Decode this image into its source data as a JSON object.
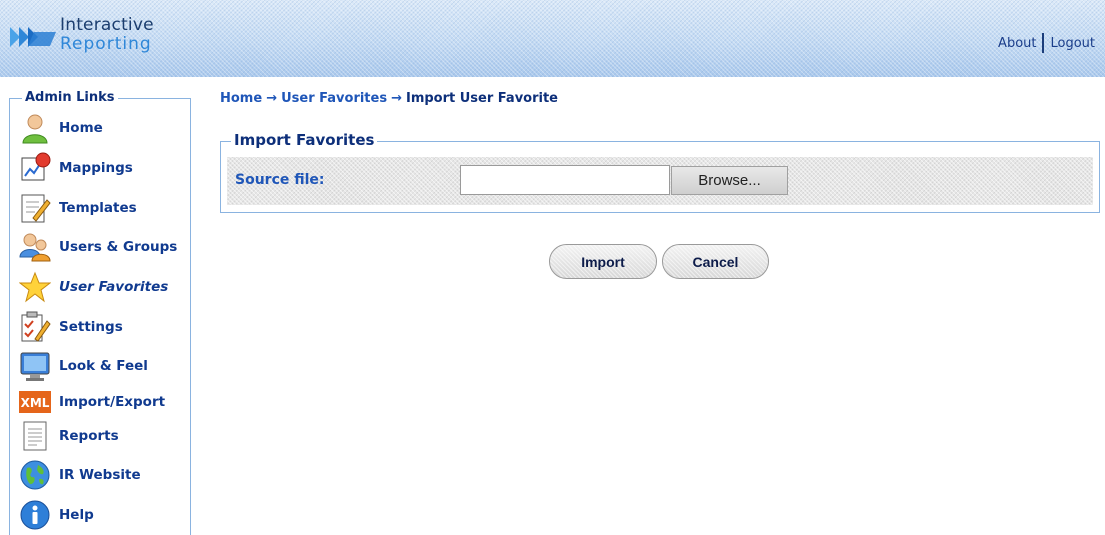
{
  "header": {
    "logo_line1": "Interactive",
    "logo_line2": "Reporting",
    "about_label": "About",
    "logout_label": "Logout"
  },
  "sidebar": {
    "title": "Admin Links",
    "items": [
      {
        "label": "Home",
        "icon": "user-icon",
        "active": false
      },
      {
        "label": "Mappings",
        "icon": "mappings-icon",
        "active": false
      },
      {
        "label": "Templates",
        "icon": "templates-icon",
        "active": false
      },
      {
        "label": "Users & Groups",
        "icon": "users-groups-icon",
        "active": false
      },
      {
        "label": "User Favorites",
        "icon": "star-icon",
        "active": true
      },
      {
        "label": "Settings",
        "icon": "settings-icon",
        "active": false
      },
      {
        "label": "Look & Feel",
        "icon": "monitor-icon",
        "active": false
      },
      {
        "label": "Import/Export",
        "icon": "xml-icon",
        "active": false
      },
      {
        "label": "Reports",
        "icon": "report-icon",
        "active": false
      },
      {
        "label": "IR Website",
        "icon": "globe-icon",
        "active": false
      },
      {
        "label": "Help",
        "icon": "info-icon",
        "active": false
      }
    ]
  },
  "breadcrumb": {
    "items": [
      "Home",
      "User Favorites",
      "Import User Favorite"
    ],
    "separator": "→"
  },
  "form": {
    "legend": "Import Favorites",
    "source_label": "Source file:",
    "source_value": "",
    "browse_label": "Browse..."
  },
  "actions": {
    "import_label": "Import",
    "cancel_label": "Cancel"
  },
  "colors": {
    "link_blue": "#1f56b8",
    "dark_navy": "#0d2f7a",
    "border_blue": "#8ab3e0"
  }
}
